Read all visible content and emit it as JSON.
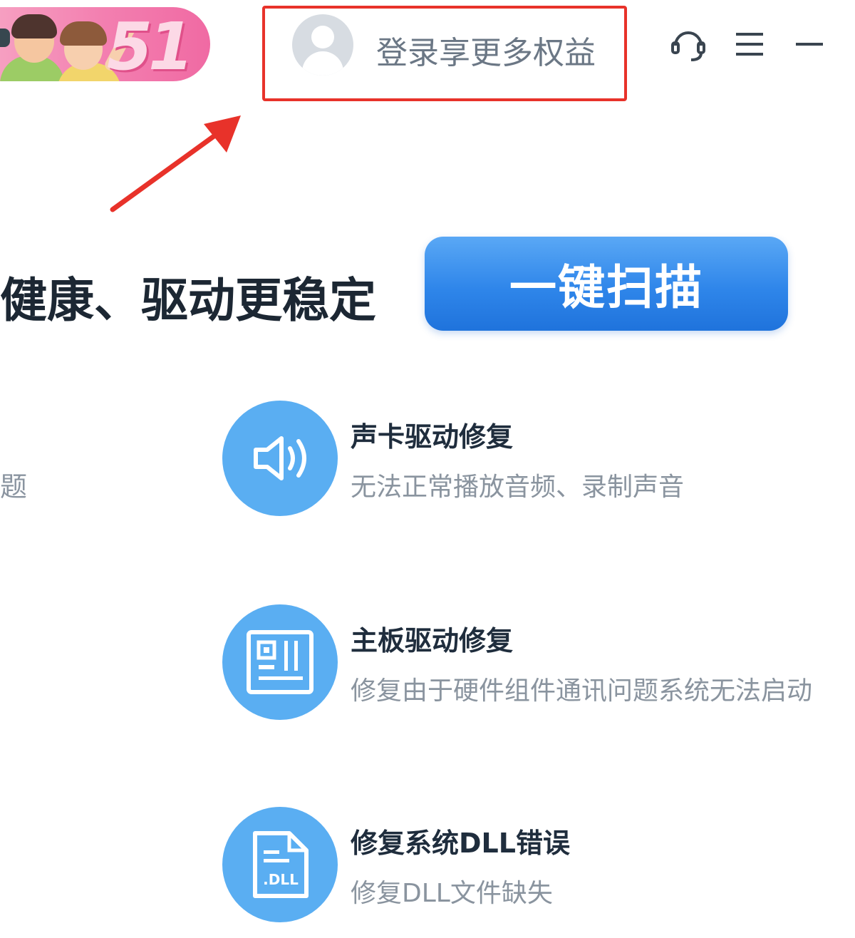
{
  "promo": {
    "badge": "51"
  },
  "account": {
    "login_label": "登录享更多权益"
  },
  "controls": {
    "support_icon": "headset-icon",
    "menu_icon": "menu-icon",
    "minimize_icon": "minimize-icon"
  },
  "hero": {
    "headline": "健康、驱动更稳定",
    "scan_label": "一键扫描"
  },
  "left_column": {
    "cut_text": "题"
  },
  "features": [
    {
      "title": "声卡驱动修复",
      "desc": "无法正常播放音频、录制声音",
      "icon": "speaker-icon"
    },
    {
      "title": "主板驱动修复",
      "desc": "修复由于硬件组件通讯问题系统无法启动",
      "icon": "motherboard-icon"
    },
    {
      "title": "修复系统DLL错误",
      "desc": "修复DLL文件缺失",
      "icon": "dll-file-icon"
    }
  ],
  "colors": {
    "accent": "#2f86ea",
    "icon_bg": "#5aaef2",
    "highlight": "#e8322a",
    "promo": "#f37fb0"
  }
}
